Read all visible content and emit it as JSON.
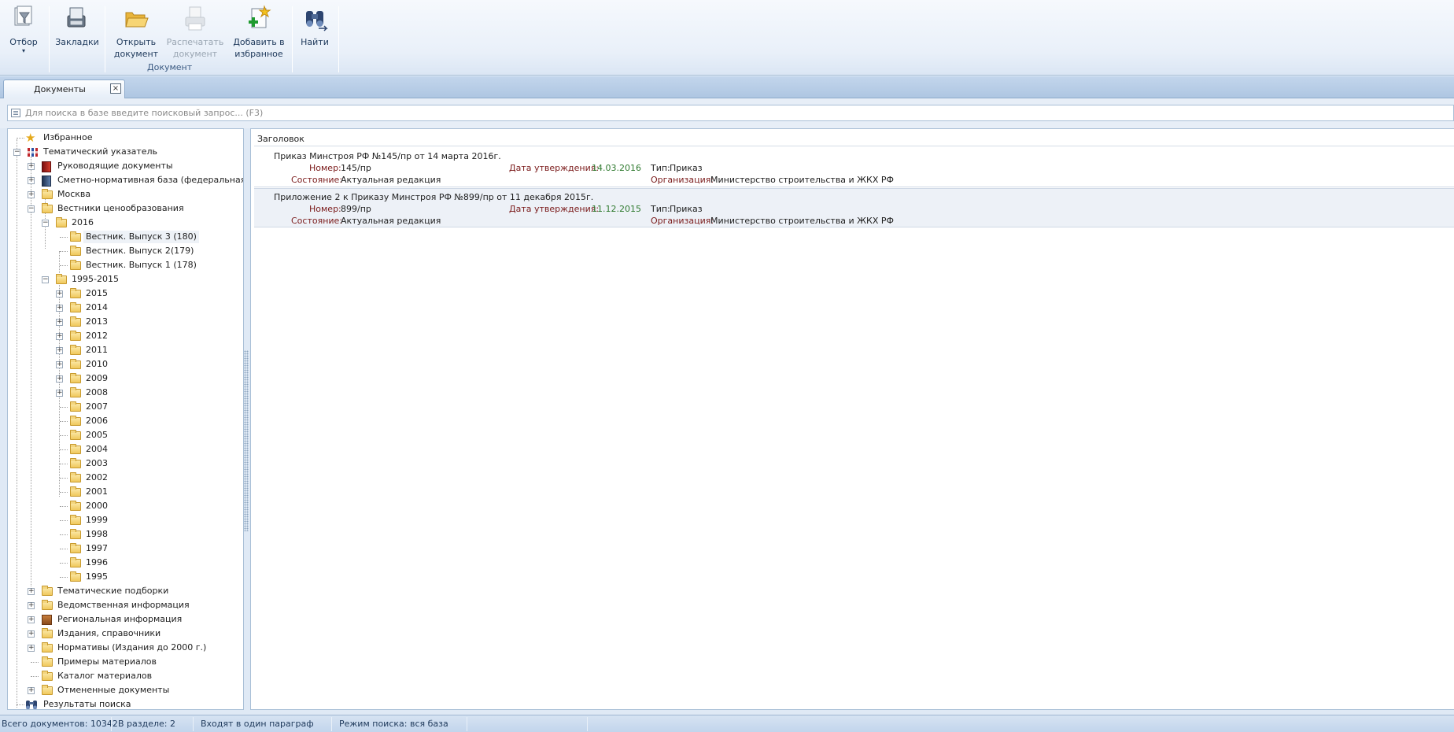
{
  "ribbon": {
    "filter_label": "Отбор",
    "bookmarks_label": "Закладки",
    "open_doc_label_1": "Открыть",
    "open_doc_label_2": "документ",
    "print_doc_label_1": "Распечатать",
    "print_doc_label_2": "документ",
    "add_fav_label_1": "Добавить в",
    "add_fav_label_2": "избранное",
    "find_label": "Найти",
    "group_label": "Документ"
  },
  "tab": {
    "label": "Документы",
    "close": "×"
  },
  "search": {
    "placeholder": "Для поиска в базе введите поисковый запрос... (F3)"
  },
  "tree": {
    "favorites": "Избранное",
    "thematic_index": "Тематический указатель",
    "guiding_docs": "Руководящие документы",
    "estimate_base": "Сметно-нормативная база (федеральная)",
    "moscow": "Москва",
    "pricing_bulletins": "Вестники ценообразования",
    "year_2016": "2016",
    "issue3": "Вестник. Выпуск 3 (180)",
    "issue2": "Вестник. Выпуск 2(179)",
    "issue1": "Вестник. Выпуск 1 (178)",
    "range_1995_2015": "1995-2015",
    "years_expandable": [
      "2015",
      "2014",
      "2013",
      "2012",
      "2011",
      "2010",
      "2009",
      "2008"
    ],
    "years_leaf": [
      "2007",
      "2006",
      "2005",
      "2004",
      "2003",
      "2002",
      "2001",
      "2000",
      "1999",
      "1998",
      "1997",
      "1996",
      "1995"
    ],
    "thematic_collections": "Тематические подборки",
    "departmental_info": "Ведомственная информация",
    "regional_info": "Региональная информация",
    "publications": "Издания, справочники",
    "norms_pre2000": "Нормативы (Издания до 2000 г.)",
    "material_examples": "Примеры материалов",
    "material_catalog": "Каталог материалов",
    "cancelled_docs": "Отмененные документы",
    "search_results": "Результаты поиска"
  },
  "results": {
    "column_header": "Заголовок",
    "labels": {
      "number": "Номер:",
      "approval_date": "Дата утверждения:",
      "type": "Тип:",
      "state": "Состояние:",
      "organization": "Организация:"
    },
    "docs": [
      {
        "title": "Приказ Минстроя РФ №145/пр от 14 марта 2016г.",
        "number": "145/пр",
        "approval_date": "14.03.2016",
        "type": "Приказ",
        "state": "Актуальная редакция",
        "organization": "Министерство строительства и ЖКХ РФ"
      },
      {
        "title": "Приложение 2 к Приказу Минстроя РФ №899/пр от 11 декабря 2015г.",
        "number": "899/пр",
        "approval_date": "11.12.2015",
        "type": "Приказ",
        "state": "Актуальная редакция",
        "organization": "Министерство строительства и ЖКХ РФ"
      }
    ]
  },
  "status": {
    "total": "Всего документов: 10342",
    "in_section": "В разделе: 2",
    "paragraph": "Входят в один параграф",
    "search_mode": "Режим поиска: вся база"
  }
}
